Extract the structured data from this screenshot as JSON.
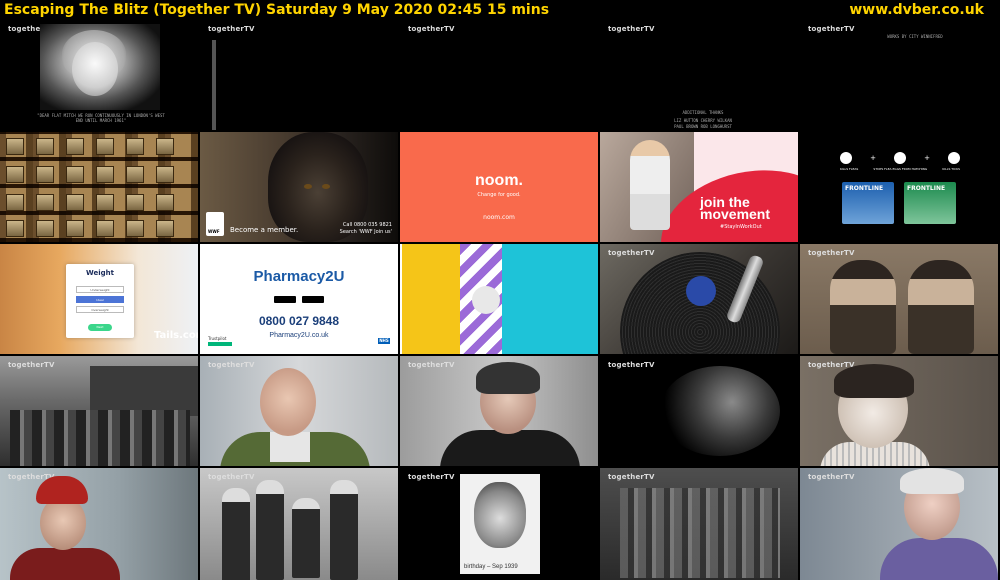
{
  "header": {
    "title": "Escaping The Blitz (Together TV)    Saturday 9 May 2020  02:45   15 mins",
    "url": "www.dvber.co.uk",
    "text_color": "#ffd400"
  },
  "watermark": "togetherTV",
  "thumbs": {
    "t00": {
      "caption": "\"DEAR FLAT MITCH WE RUN CONTINUOUSLY IN LONDON'S WEST END UNTIL MARCH 1961\""
    },
    "t04": {
      "line1": "WORKS BY CITY WINNIFRED"
    },
    "t03": {
      "credits": "ADDITIONAL THANKS",
      "line2": "LIZ HUTTON          CHERRY WILKAN",
      "line3": "PAUL BROWN          ROB LONGHURST"
    },
    "t11": {
      "logo": "WWF",
      "tagline": "Become a member.",
      "call": "Call 0800 035 9821",
      "search": "Search 'WWF Join us'"
    },
    "t12": {
      "brand": "noom.",
      "tagline": "Change for good.",
      "site": "noom.com"
    },
    "t13": {
      "headline1": "join the",
      "headline2": "movement",
      "hashtag": "#StayInWorkOut"
    },
    "t14": {
      "kills1": "KILLS FLEAS",
      "kills2": "STOPS FLEA EGGS FROM HATCHING",
      "kills3": "KILLS TICKS",
      "brand1": "FRONTLINE",
      "brand2": "FRONTLINE"
    },
    "t20": {
      "card_title": "Weight",
      "opt1": "Underweight",
      "opt2": "Ideal",
      "opt3": "Overweight",
      "button": "Next",
      "brand": "Tails.com"
    },
    "t21": {
      "brand": "Pharmacy2U",
      "phone": "0800 027 9848",
      "site": "Pharmacy2U.co.uk",
      "trustpilot": "Trustpilot",
      "nhs": "NHS"
    },
    "t42": {
      "caption": "birthday – Sep 1939"
    }
  }
}
